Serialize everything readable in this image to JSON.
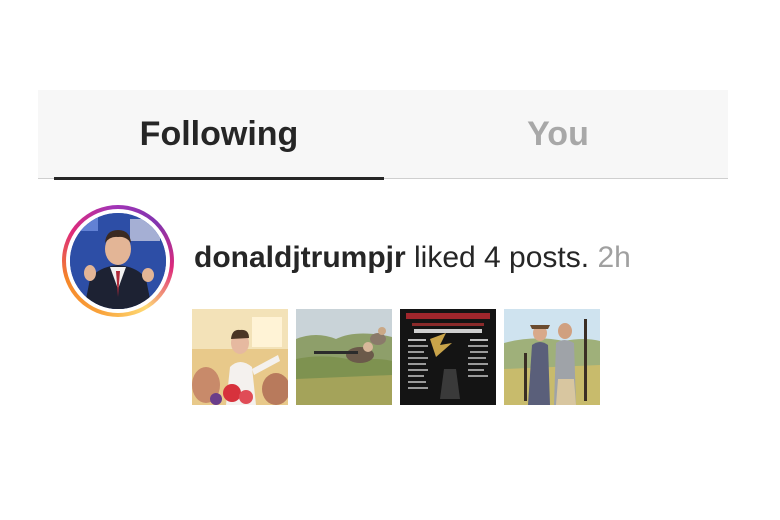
{
  "tabs": {
    "following_label": "Following",
    "you_label": "You"
  },
  "activity": {
    "username": "donaldjtrumpjr",
    "action": "liked 4 posts.",
    "time": "2h",
    "posts": [
      {
        "name": "liked-post-1"
      },
      {
        "name": "liked-post-2"
      },
      {
        "name": "liked-post-3"
      },
      {
        "name": "liked-post-4"
      }
    ]
  },
  "colors": {
    "active_tab": "#262626",
    "inactive_tab": "#a8a8a8",
    "timestamp": "#a0a0a0",
    "tabbar_bg": "#f7f7f7"
  }
}
